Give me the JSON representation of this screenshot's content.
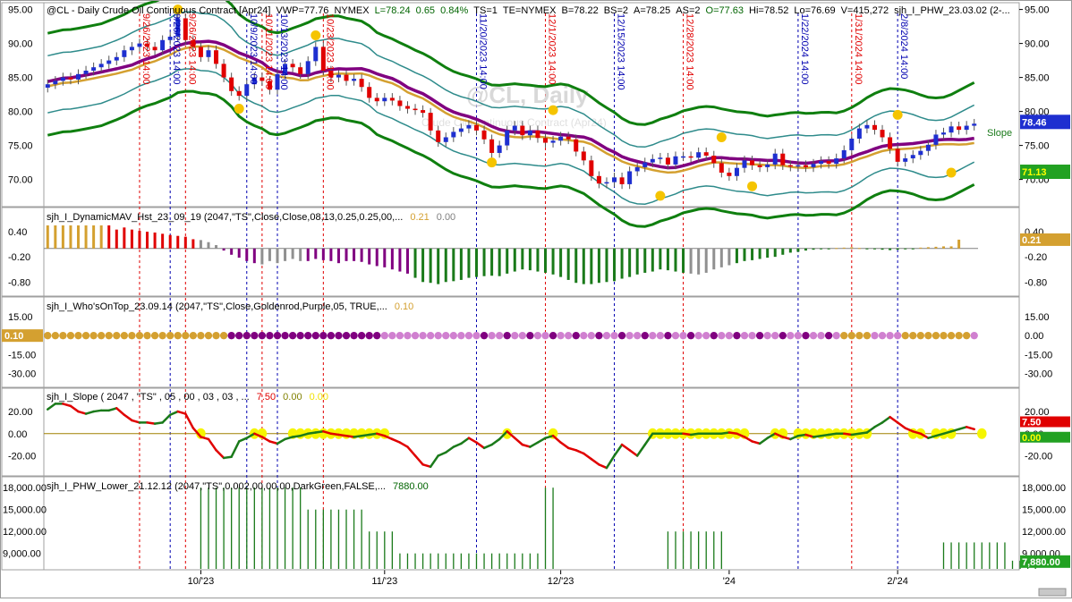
{
  "chart_data": [
    {
      "type": "candlestick",
      "header": {
        "symbol_title": "@CL - Daily  Crude Oil Continuous Contract [Apr24]",
        "stats": [
          {
            "text": "VWP=77.76",
            "color": "#000000"
          },
          {
            "text": "NYMEX",
            "color": "#000000"
          },
          {
            "text": "L=78.24",
            "color": "#006400"
          },
          {
            "text": "0.65",
            "color": "#006400"
          },
          {
            "text": "0.84%",
            "color": "#006400"
          },
          {
            "text": "TS=1",
            "color": "#000000"
          },
          {
            "text": "TE=NYMEX",
            "color": "#000000"
          },
          {
            "text": "B=78.22",
            "color": "#000000"
          },
          {
            "text": "BS=2",
            "color": "#000000"
          },
          {
            "text": "A=78.25",
            "color": "#000000"
          },
          {
            "text": "AS=2",
            "color": "#000000"
          },
          {
            "text": "O=77.63",
            "color": "#006400"
          },
          {
            "text": "Hi=78.52",
            "color": "#000000"
          },
          {
            "text": "Lo=76.69",
            "color": "#000000"
          },
          {
            "text": "V=415,272",
            "color": "#000000"
          },
          {
            "text": "sjh_I_PHW_23.03.02 (2-...",
            "color": "#000000"
          }
        ]
      },
      "watermark": "@CL, Daily",
      "watermark_sub": "Crude Oil Continuous Contract (Apr24)",
      "y_ticks": [
        "95.00",
        "90.00",
        "85.00",
        "80.00",
        "75.00",
        "70.00"
      ],
      "ylim": [
        66,
        96
      ],
      "right_labels": [
        {
          "text": "78.46",
          "value": 78.46,
          "bg": "#1e2fd0",
          "fg": "#ffffff"
        },
        {
          "text": "71.13",
          "value": 71.13,
          "bg": "#22a122",
          "fg": "#ffff00"
        }
      ],
      "slope_label": "Slope",
      "close": [
        84,
        84.5,
        85,
        84.7,
        85.5,
        86,
        86.5,
        87,
        87.5,
        88,
        89,
        89.5,
        90,
        89.5,
        89,
        90.5,
        91,
        93.7,
        90.5,
        89.5,
        88,
        89,
        87,
        85,
        83,
        82.3,
        84,
        85,
        84.5,
        83.2,
        85.5,
        87,
        86.5,
        85.5,
        87.4,
        89.5,
        86,
        85,
        85.4,
        84.5,
        84.8,
        83.6,
        82,
        81.5,
        82,
        81.6,
        80.8,
        80.4,
        80.2,
        79.8,
        77.2,
        75.5,
        76.2,
        77,
        77.5,
        78,
        77.2,
        75.9,
        73.9,
        75,
        77.2,
        77.9,
        76.5,
        77.2,
        76.1,
        75.4,
        75.7,
        76.3,
        75.9,
        74.1,
        72.8,
        70.5,
        69.4,
        69.6,
        70.3,
        69.3,
        71.2,
        71.8,
        72.5,
        73,
        73.2,
        72.2,
        73.4,
        73.4,
        73.2,
        74,
        73.5,
        72.4,
        71,
        70.5,
        71.7,
        72.8,
        72.1,
        71.8,
        72.2,
        73.8,
        72.1,
        71.9,
        72.1,
        71.8,
        72.3,
        72.7,
        72.3,
        73.1,
        74.3,
        76,
        77.5,
        78,
        77.3,
        76.2,
        74.5,
        72.6,
        73.1,
        73.6,
        74.2,
        75.1,
        76.6,
        76.9,
        77.8,
        77.3,
        77.9,
        78.2
      ],
      "markers_high": [
        [
          17,
          95
        ],
        [
          35,
          91.2
        ],
        [
          66,
          80.2
        ],
        [
          88,
          76.2
        ],
        [
          111,
          79.5
        ]
      ],
      "markers_low": [
        [
          25,
          80.4
        ],
        [
          58,
          72.5
        ],
        [
          80,
          67.6
        ],
        [
          92,
          69
        ],
        [
          118,
          71
        ]
      ],
      "dates": [
        {
          "label": "9/26/2023 14:00",
          "idx": 12,
          "color": "#e00000"
        },
        {
          "label": "9/26/2023 14:00",
          "idx": 16,
          "color": "#0000b0"
        },
        {
          "label": "9/26/2023 14:00",
          "idx": 18,
          "color": "#e00000"
        },
        {
          "label": "10/9/2023 14:00",
          "idx": 26,
          "color": "#0000b0"
        },
        {
          "label": "10/11/2023 14:00",
          "idx": 28,
          "color": "#e00000"
        },
        {
          "label": "10/13/2023 14:00",
          "idx": 30,
          "color": "#0000b0"
        },
        {
          "label": "10/23/2023 14:00",
          "idx": 36,
          "color": "#e00000"
        },
        {
          "label": "11/20/2023 14:00",
          "idx": 56,
          "color": "#0000b0"
        },
        {
          "label": "12/1/2023 14:00",
          "idx": 65,
          "color": "#e00000"
        },
        {
          "label": "12/15/2023 14:00",
          "idx": 74,
          "color": "#0000b0"
        },
        {
          "label": "12/28/2023 14:00",
          "idx": 83,
          "color": "#e00000"
        },
        {
          "label": "1/22/2024 14:00",
          "idx": 98,
          "color": "#0000b0"
        },
        {
          "label": "1/31/2024 14:00",
          "idx": 105,
          "color": "#e00000"
        },
        {
          "label": "2/8/2024 14:00",
          "idx": 111,
          "color": "#0000b0"
        }
      ]
    },
    {
      "type": "bar",
      "title": "sjh_I_DynamicMAV_Hst_23_09_19 (2047,\"TS\",Close,Close,08,13,0.25,0.25,00,...",
      "values_text": [
        {
          "text": "0.21",
          "color": "#d4a030"
        },
        {
          "text": "0.00",
          "color": "#808080"
        }
      ],
      "y_ticks": [
        "0.40",
        "-0.20",
        "-0.80"
      ],
      "ylim": [
        -1.05,
        0.72
      ],
      "right_labels": [
        {
          "text": "0.21",
          "value": 0.21,
          "bg": "#d4a030",
          "fg": "#ffffff"
        }
      ],
      "values": [
        0.55,
        0.55,
        0.55,
        0.55,
        0.55,
        0.55,
        0.55,
        0.55,
        0.55,
        0.45,
        0.5,
        0.45,
        0.42,
        0.4,
        0.38,
        0.35,
        0.32,
        0.3,
        0.28,
        0.22,
        0.2,
        0.15,
        0.08,
        -0.05,
        -0.15,
        -0.22,
        -0.3,
        -0.35,
        -0.38,
        -0.3,
        -0.35,
        -0.3,
        -0.25,
        -0.3,
        -0.3,
        -0.25,
        -0.28,
        -0.3,
        -0.35,
        -0.3,
        -0.3,
        -0.32,
        -0.38,
        -0.42,
        -0.45,
        -0.5,
        -0.55,
        -0.6,
        -0.7,
        -0.8,
        -0.82,
        -0.85,
        -0.8,
        -0.78,
        -0.75,
        -0.7,
        -0.68,
        -0.66,
        -0.65,
        -0.66,
        -0.6,
        -0.55,
        -0.5,
        -0.52,
        -0.55,
        -0.58,
        -0.62,
        -0.68,
        -0.75,
        -0.82,
        -0.85,
        -0.85,
        -0.82,
        -0.8,
        -0.78,
        -0.72,
        -0.68,
        -0.62,
        -0.58,
        -0.55,
        -0.5,
        -0.52,
        -0.55,
        -0.58,
        -0.6,
        -0.62,
        -0.58,
        -0.5,
        -0.45,
        -0.4,
        -0.35,
        -0.3,
        -0.28,
        -0.25,
        -0.22,
        -0.2,
        -0.15,
        -0.1,
        -0.08,
        -0.05,
        -0.03,
        -0.02,
        -0.01,
        0.01,
        0.02,
        0.03,
        0.01,
        -0.01,
        -0.02,
        -0.03,
        -0.04,
        -0.03,
        -0.02,
        -0.01,
        0.02,
        0.03,
        0.04,
        0.05,
        0.05,
        0.21
      ]
    },
    {
      "type": "dots",
      "title": "sjh_I_Who'sOnTop_23.09.14 (2047,\"TS\",Close,Goldenrod,Purple,05,  TRUE,...",
      "values_text": [
        {
          "text": "0.10",
          "color": "#d4a030"
        }
      ],
      "y_ticks": [
        "15.00",
        "0.00",
        "-15.00",
        "-30.00"
      ],
      "ylim": [
        -38,
        22
      ],
      "left_label": {
        "text": "0.10",
        "bg": "#d4a030",
        "fg": "#ffffff"
      },
      "dot_value": 0,
      "states": "GGGGGGGGGGGGGGGGGGGGGGGGPPPPPPPPPPPPPPPPPPPPPPPPPPPPPPPPPPPPPPPPPPPPPPPPPPPPPPPPPPPPPPPPPPPPPPPPPPPPPPPPPPPPPPPPGGGGGGGGG"
    },
    {
      "type": "line",
      "title": "sjh_I_Slope ( 2047 , \"TS\" , 05 , 00 , 03 , 03 , ...",
      "values_text": [
        {
          "text": "7.50",
          "color": "#e00000"
        },
        {
          "text": "0.00",
          "color": "#808000"
        },
        {
          "text": "0.00",
          "color": "#f0e000"
        }
      ],
      "y_ticks": [
        "20.00",
        "0.00",
        "-20.00"
      ],
      "ylim": [
        -35,
        33
      ],
      "right_labels": [
        {
          "text": "7.50",
          "value": 7.5,
          "bg": "#e00000",
          "fg": "#ffffff"
        },
        {
          "text": "0.00",
          "value": 0,
          "bg": "#22a122",
          "fg": "#ffff00"
        }
      ],
      "values": [
        22,
        27,
        27,
        25,
        20,
        18,
        20,
        21,
        21,
        23,
        17,
        12,
        10,
        10,
        9,
        10,
        17,
        20,
        18,
        5,
        -3,
        -5,
        -15,
        -22,
        -21,
        -7,
        -4,
        0,
        -3,
        -7,
        -9,
        -5,
        -3,
        -2,
        0,
        1,
        2,
        0,
        -1,
        -2,
        -3,
        -2,
        -1,
        0,
        -2,
        -5,
        -8,
        -12,
        -20,
        -28,
        -30,
        -20,
        -17,
        -12,
        -9,
        -4,
        -8,
        -13,
        -10,
        -5,
        2,
        -4,
        -10,
        -12,
        -8,
        -4,
        -2,
        -8,
        -13,
        -15,
        -18,
        -23,
        -28,
        -31,
        -20,
        -10,
        -15,
        -20,
        -10,
        0,
        0,
        0,
        0,
        0,
        -1,
        0,
        0,
        0,
        0,
        1,
        0,
        -3,
        -7,
        -9,
        -4,
        0,
        -3,
        -5,
        -2,
        -1,
        -3,
        -2,
        -1,
        0,
        0,
        -1,
        0,
        1,
        6,
        10,
        15,
        10,
        5,
        2,
        0,
        -4,
        -2,
        0,
        2,
        4,
        6,
        4,
        3,
        4,
        7.5
      ],
      "zero_line_color": "#a08000"
    },
    {
      "type": "bar",
      "title": "sjh_I_PHW_Lower_21.12.12 (2047,\"TS\",0.002,00,00,00,DarkGreen,FALSE,...",
      "values_text": [
        {
          "text": "7880.00",
          "color": "#006400"
        }
      ],
      "y_ticks": [
        "18,000.00",
        "15,000.00",
        "12,000.00",
        "9,000.00"
      ],
      "ylim": [
        7000,
        19000
      ],
      "right_ticks": [
        "18,000.00",
        "15,000.00",
        "12,000.00",
        "9,000.00"
      ],
      "right_labels": [
        {
          "text": "7,880.00",
          "value": 7880,
          "bg": "#22a122",
          "fg": "#ffffff"
        }
      ],
      "values": [
        0,
        0,
        0,
        0,
        0,
        0,
        0,
        0,
        0,
        0,
        0,
        0,
        0,
        0,
        0,
        0,
        0,
        0,
        0,
        0,
        18000,
        18000,
        18000,
        18000,
        18000,
        18000,
        18000,
        18000,
        18000,
        18000,
        18000,
        18000,
        18000,
        18000,
        15000,
        15000,
        15000,
        15000,
        15000,
        15000,
        15000,
        15000,
        12000,
        12000,
        12000,
        12000,
        9000,
        9000,
        9000,
        9000,
        9000,
        9000,
        9000,
        9000,
        9000,
        9000,
        9000,
        9000,
        9000,
        9000,
        9000,
        9000,
        9000,
        9000,
        9000,
        18000,
        18000,
        0,
        0,
        0,
        0,
        0,
        0,
        0,
        0,
        0,
        0,
        0,
        0,
        0,
        0,
        12000,
        12000,
        12000,
        12000,
        12000,
        12000,
        12000,
        12000,
        0,
        0,
        0,
        0,
        0,
        0,
        0,
        0,
        0,
        0,
        0,
        0,
        0,
        0,
        0,
        0,
        0,
        0,
        0,
        0,
        0,
        0,
        0,
        0,
        0,
        0,
        0,
        0,
        10500,
        10500,
        10500,
        10500,
        10500,
        10500,
        10500,
        10500,
        10500,
        8000,
        8000,
        8000,
        8000
      ],
      "bar_color": "#1a7a1a"
    }
  ],
  "x_axis_labels": [
    {
      "text": "10/'23",
      "idx": 20
    },
    {
      "text": "11/'23",
      "idx": 44
    },
    {
      "text": "12/'23",
      "idx": 67
    },
    {
      "text": "'24",
      "idx": 89
    },
    {
      "text": "2/'24",
      "idx": 111
    }
  ],
  "colors": {
    "up": "#1e2fd0",
    "down": "#e00000",
    "band_green": "#0f7f0f",
    "band_teal": "#2e8b8b",
    "ma_purple": "#800080",
    "ma_gold": "#d4a030",
    "slope_down": "#e00000",
    "slope_up": "#1a7a1a",
    "highlight": "#f5f500",
    "marker": "#f5c400",
    "who_gold": "#d4a030",
    "who_purple_dark": "#800080",
    "who_purple_light": "#d080d0"
  }
}
